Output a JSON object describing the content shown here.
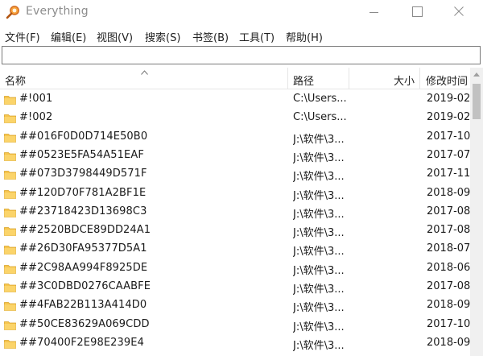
{
  "window": {
    "title": "Everything",
    "icon": "magnifier-app-icon",
    "accent_color": "#e07a1f"
  },
  "menu": [
    {
      "label": "文件(F)"
    },
    {
      "label": "编辑(E)"
    },
    {
      "label": "视图(V)"
    },
    {
      "label": "搜索(S)"
    },
    {
      "label": "书签(B)"
    },
    {
      "label": "工具(T)"
    },
    {
      "label": "帮助(H)"
    }
  ],
  "search": {
    "value": "",
    "placeholder": ""
  },
  "columns": {
    "name": "名称",
    "path": "路径",
    "size": "大小",
    "date": "修改时间"
  },
  "sort": {
    "column": "name",
    "direction": "ascending"
  },
  "rows": [
    {
      "name": "#!001",
      "path": "C:\\Users...",
      "date": "2019-02"
    },
    {
      "name": "#!002",
      "path": "C:\\Users...",
      "date": "2019-02"
    },
    {
      "name": "##016F0D0D714E50B0",
      "path": "J:\\软件\\3...",
      "date": "2017-10"
    },
    {
      "name": "##0523E5FA54A51EAF",
      "path": "J:\\软件\\3...",
      "date": "2017-07"
    },
    {
      "name": "##073D3798449D571F",
      "path": "J:\\软件\\3...",
      "date": "2017-11"
    },
    {
      "name": "##120D70F781A2BF1E",
      "path": "J:\\软件\\3...",
      "date": "2018-09"
    },
    {
      "name": "##23718423D13698C3",
      "path": "J:\\软件\\3...",
      "date": "2017-08"
    },
    {
      "name": "##2520BDCE89DD24A1",
      "path": "J:\\软件\\3...",
      "date": "2017-08"
    },
    {
      "name": "##26D30FA95377D5A1",
      "path": "J:\\软件\\3...",
      "date": "2018-07"
    },
    {
      "name": "##2C98AA994F8925DE",
      "path": "J:\\软件\\3...",
      "date": "2018-06"
    },
    {
      "name": "##3C0DBD0276CAABFE",
      "path": "J:\\软件\\3...",
      "date": "2017-08"
    },
    {
      "name": "##4FAB22B113A414D0",
      "path": "J:\\软件\\3...",
      "date": "2018-09"
    },
    {
      "name": "##50CE83629A069CDD",
      "path": "J:\\软件\\3...",
      "date": "2017-10"
    },
    {
      "name": "##70400F2E98E239E4",
      "path": "J:\\软件\\3...",
      "date": "2018-09"
    }
  ]
}
